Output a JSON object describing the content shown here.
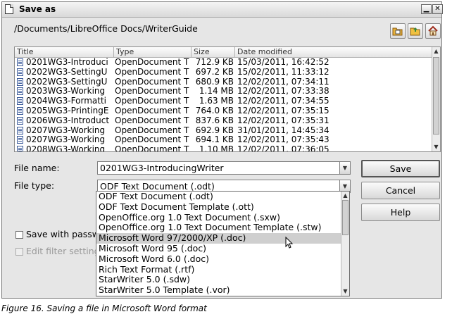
{
  "window": {
    "title": "Save as",
    "minimize_glyph": "▁",
    "close_glyph": "✕"
  },
  "path": "/Documents/LibreOffice Docs/WriterGuide",
  "toolbar": {
    "icons": [
      "new-folder-icon",
      "folder-icon",
      "home-icon"
    ]
  },
  "columns": [
    "Title",
    "Type",
    "Size",
    "Date modified"
  ],
  "files": [
    {
      "title": "0201WG3-Introduci",
      "type": "OpenDocument T",
      "size": "712.9 KB",
      "date": "15/03/2011, 16:42:52"
    },
    {
      "title": "0202WG3-SettingU",
      "type": "OpenDocument T",
      "size": "697.2 KB",
      "date": "15/02/2011, 11:33:12"
    },
    {
      "title": "0202WG3-SettingU",
      "type": "OpenDocument T",
      "size": "680.9 KB",
      "date": "12/02/2011, 07:34:11"
    },
    {
      "title": "0203WG3-Working",
      "type": "OpenDocument T",
      "size": "1.14 MB",
      "date": "12/02/2011, 07:33:38"
    },
    {
      "title": "0204WG3-Formatti",
      "type": "OpenDocument T",
      "size": "1.63 MB",
      "date": "12/02/2011, 07:34:55"
    },
    {
      "title": "0205WG3-PrintingE",
      "type": "OpenDocument T",
      "size": "764.0 KB",
      "date": "12/02/2011, 07:35:15"
    },
    {
      "title": "0206WG3-Introduct",
      "type": "OpenDocument T",
      "size": "837.6 KB",
      "date": "12/02/2011, 07:35:31"
    },
    {
      "title": "0207WG3-Working",
      "type": "OpenDocument T",
      "size": "692.9 KB",
      "date": "31/01/2011, 14:45:34"
    },
    {
      "title": "0207WG3-Working",
      "type": "OpenDocument T",
      "size": "694.1 KB",
      "date": "12/02/2011, 07:35:43"
    },
    {
      "title": "0208WG3-Working",
      "type": "OpenDocument T",
      "size": "1.10 MB",
      "date": "12/02/2011, 07:36:05"
    }
  ],
  "form": {
    "file_name_label": "File name:",
    "file_name_value": "0201WG3-IntroducingWriter",
    "file_type_label": "File type:",
    "file_type_value": "ODF Text Document (.odt)",
    "save_with_password_label": "Save with passwo",
    "edit_filter_label": "Edit filter settings"
  },
  "buttons": {
    "save": "Save",
    "cancel": "Cancel",
    "help": "Help"
  },
  "file_type_options": [
    "ODF Text Document (.odt)",
    "ODF Text Document Template (.ott)",
    "OpenOffice.org 1.0 Text Document (.sxw)",
    "OpenOffice.org 1.0 Text Document Template (.stw)",
    "Microsoft Word 97/2000/XP (.doc)",
    "Microsoft Word 95 (.doc)",
    "Microsoft Word 6.0 (.doc)",
    "Rich Text Format (.rtf)",
    "StarWriter 5.0 (.sdw)",
    "StarWriter 5.0 Template (.vor)"
  ],
  "selected_option": 4,
  "caption": "Figure 16. Saving a file in Microsoft Word format"
}
